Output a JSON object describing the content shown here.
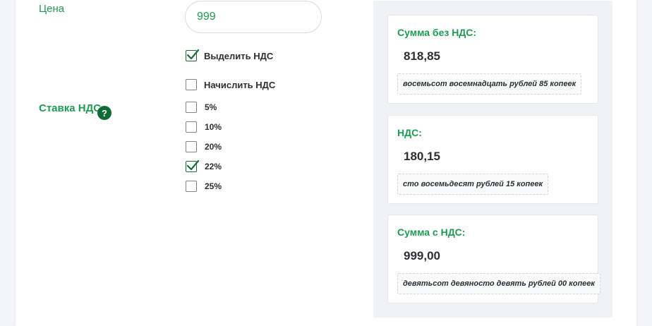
{
  "form": {
    "price_label": "Цена",
    "price_value": "999",
    "options": [
      {
        "label": "Выделить НДС",
        "checked": true
      },
      {
        "label": "Начислить НДС",
        "checked": false
      }
    ],
    "rate_label": "Ставка НДС",
    "help_icon": "?",
    "rates": [
      {
        "label": "5%",
        "checked": false
      },
      {
        "label": "10%",
        "checked": false
      },
      {
        "label": "20%",
        "checked": false
      },
      {
        "label": "22%",
        "checked": true
      },
      {
        "label": "25%",
        "checked": false
      }
    ]
  },
  "results": [
    {
      "title": "Сумма без НДС:",
      "value": "818,85",
      "words": "восемьсот восемнадцать рублей 85 копеек"
    },
    {
      "title": "НДС:",
      "value": "180,15",
      "words": "сто восемьдесят рублей 15 копеек"
    },
    {
      "title": "Сумма с НДС:",
      "value": "999,00",
      "words": "девятьсот девяносто девять рублей 00 копеек"
    }
  ],
  "colors": {
    "accent_green": "#1f9a55",
    "dark_green": "#1d6b3b",
    "text": "#2b2f33"
  },
  "icons": {
    "checked": "checkmark-icon",
    "help": "question-icon"
  }
}
